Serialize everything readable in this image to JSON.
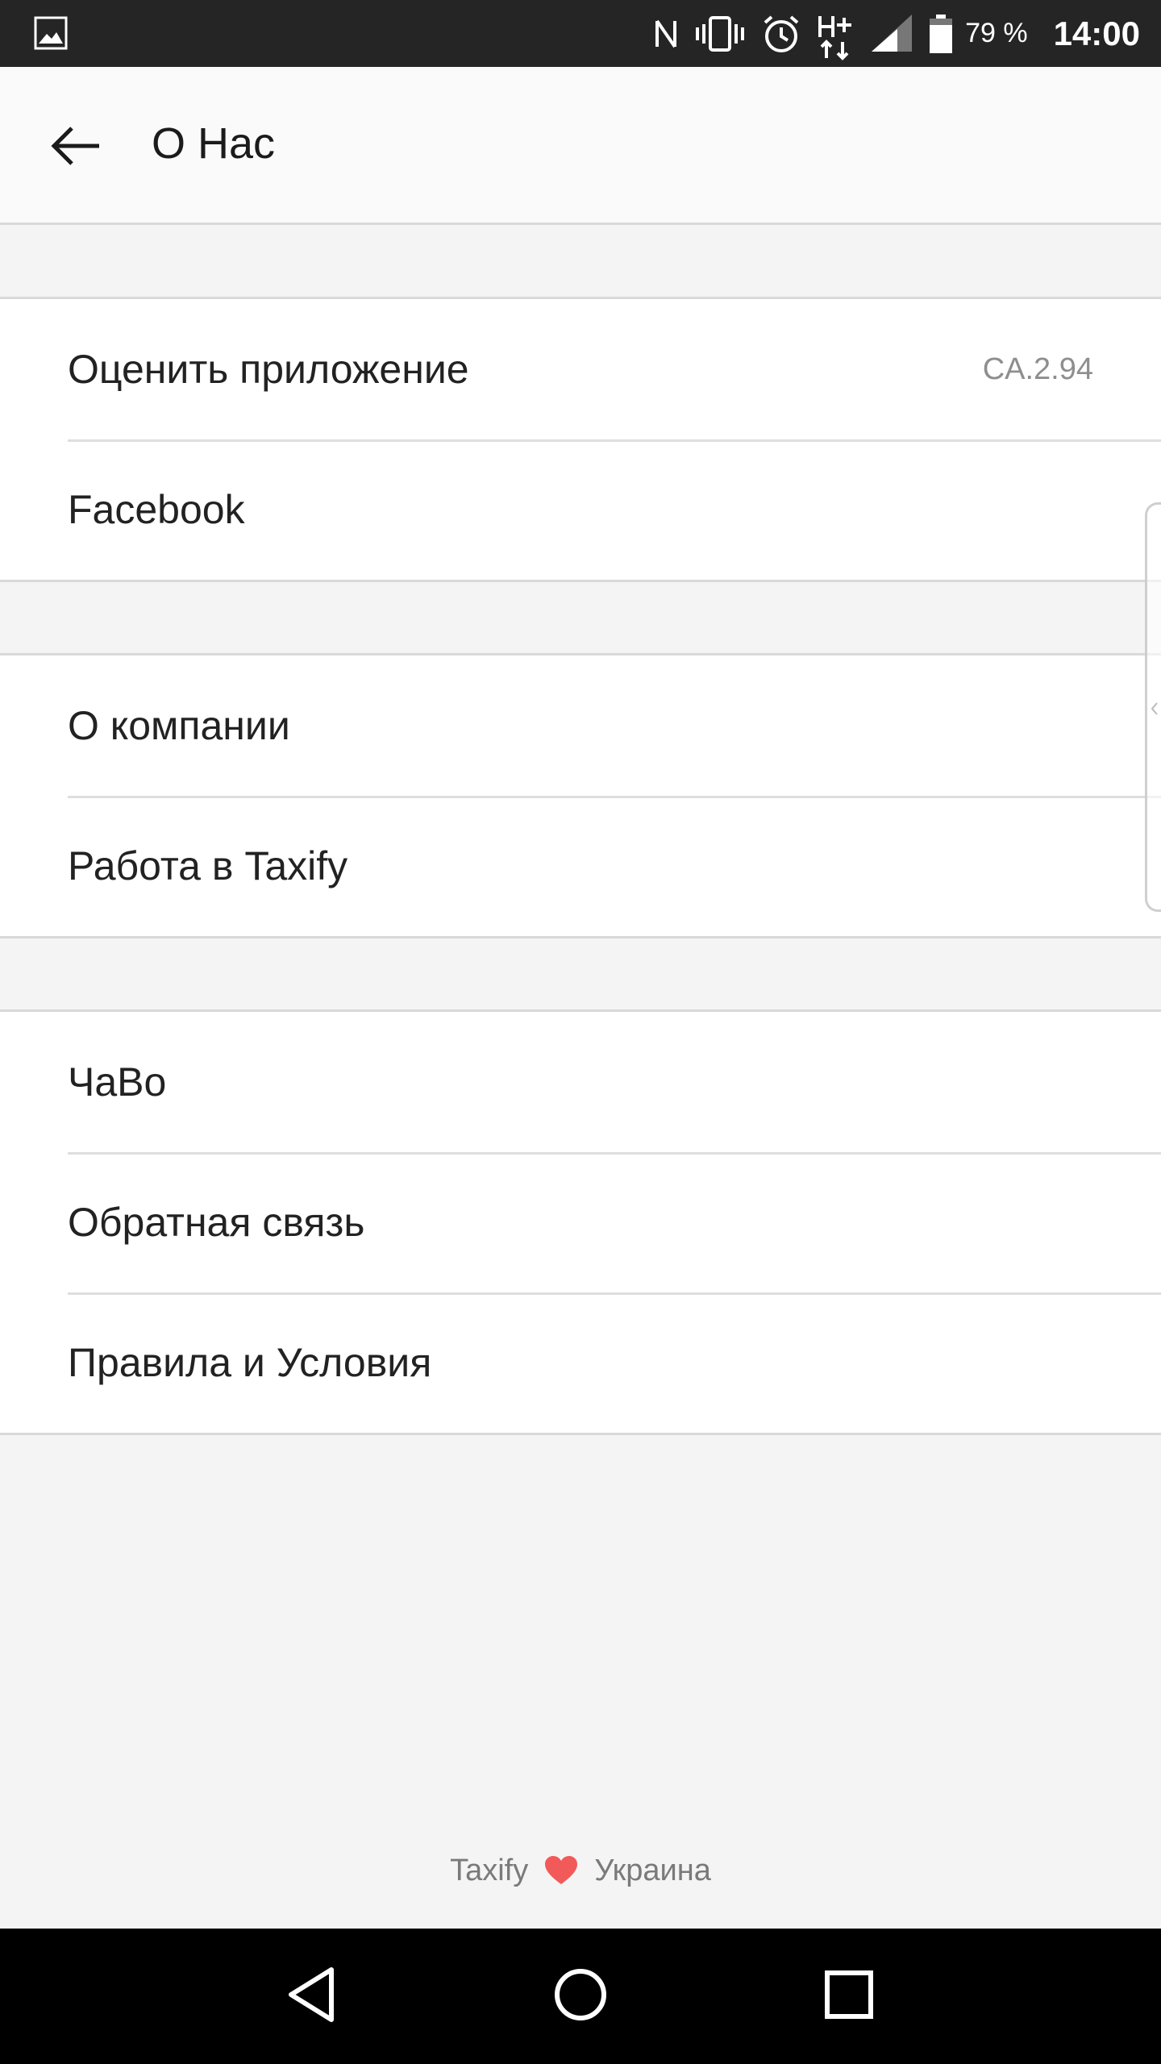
{
  "status_bar": {
    "battery_percent": "79 %",
    "time": "14:00",
    "icons": [
      "image-icon",
      "nfc-icon",
      "vibrate-icon",
      "alarm-icon",
      "h-plus-data-icon",
      "signal-icon",
      "battery-icon"
    ]
  },
  "header": {
    "title": "О Нас",
    "back_icon": "arrow-left-icon"
  },
  "groups": [
    {
      "items": [
        {
          "label": "Оценить приложение",
          "value": "CA.2.94"
        },
        {
          "label": "Facebook"
        }
      ]
    },
    {
      "items": [
        {
          "label": "О компании"
        },
        {
          "label": "Работа в Taxify"
        }
      ]
    },
    {
      "items": [
        {
          "label": "ЧаВо"
        },
        {
          "label": "Обратная связь"
        },
        {
          "label": "Правила и Условия"
        }
      ]
    }
  ],
  "footer": {
    "brand": "Taxify",
    "country": "Украина",
    "heart_color": "#f25a5a"
  },
  "nav_bar": {
    "icons": [
      "back-triangle-icon",
      "home-circle-icon",
      "recents-square-icon"
    ]
  },
  "colors": {
    "status_bar_bg": "#252525",
    "app_bar_bg": "#fafafa",
    "page_bg": "#f4f4f4",
    "divider": "#d9d9d9"
  }
}
